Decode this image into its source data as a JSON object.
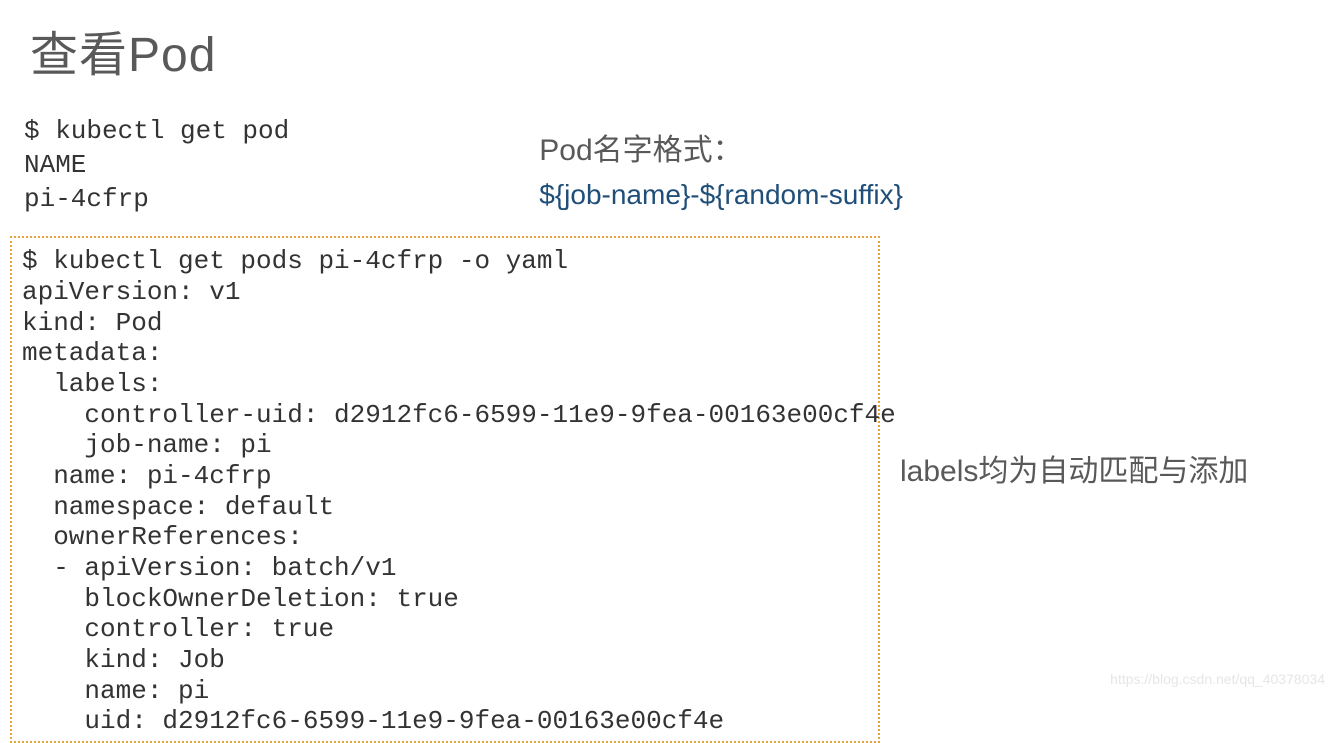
{
  "heading": "查看Pod",
  "command_block": "$ kubectl get pod\nNAME\npi-4cfrp",
  "name_format": {
    "label": "Pod名字格式：",
    "pattern": "${job-name}-${random-suffix}"
  },
  "yaml_block": "$ kubectl get pods pi-4cfrp -o yaml\napiVersion: v1\nkind: Pod\nmetadata:\n  labels:\n    controller-uid: d2912fc6-6599-11e9-9fea-00163e00cf4e\n    job-name: pi\n  name: pi-4cfrp\n  namespace: default\n  ownerReferences:\n  - apiVersion: batch/v1\n    blockOwnerDeletion: true\n    controller: true\n    kind: Job\n    name: pi\n    uid: d2912fc6-6599-11e9-9fea-00163e00cf4e",
  "yaml_annotation": "labels均为自动匹配与添加",
  "watermark": "https://blog.csdn.net/qq_40378034"
}
